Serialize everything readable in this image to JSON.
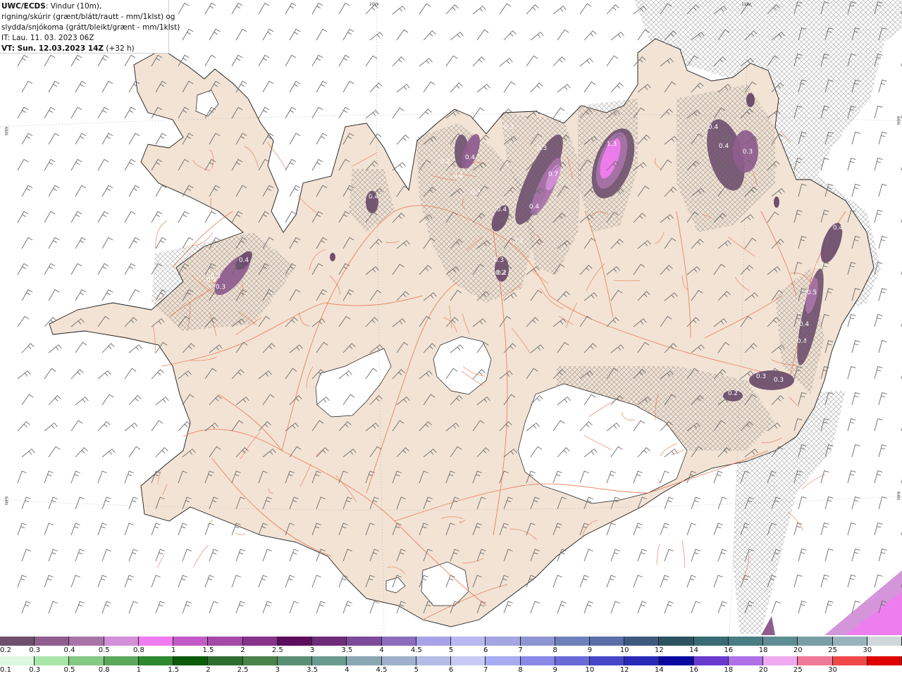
{
  "header": {
    "model": "UWC/ECDS",
    "line1_rest": ": Vindur (10m),",
    "line2": "rigning/skúrir (grænt/blátt/rautt - mm/1klst) og",
    "line3": "slydda/snjókoma (grátt/bleikt/grænt - mm/1klst)",
    "line4": "IT: Lau. 11. 03. 2023 06Z",
    "line5_bold": "VT: Sun. 12.03.2023 14Z",
    "line5_rest": " (+32 h)"
  },
  "grid_labels": {
    "top": [
      "20W",
      "15W"
    ],
    "left": [
      "66N",
      "64N"
    ],
    "right": [
      "66N",
      "64N"
    ]
  },
  "precip_labels": [
    {
      "text": "0.3"
    },
    {
      "text": "0.3"
    },
    {
      "text": "0.3"
    },
    {
      "text": "0.2"
    },
    {
      "text": "0.4"
    },
    {
      "text": "0.4"
    },
    {
      "text": "0.2"
    },
    {
      "text": "0.3"
    },
    {
      "text": "0.7"
    },
    {
      "text": "0.4"
    },
    {
      "text": "0.4"
    },
    {
      "text": "0.4"
    },
    {
      "text": "0.3"
    },
    {
      "text": "0.3"
    },
    {
      "text": "0.2"
    },
    {
      "text": "1.3"
    },
    {
      "text": "0.4"
    },
    {
      "text": "0.4"
    },
    {
      "text": "0.3"
    },
    {
      "text": "0.4"
    },
    {
      "text": "0.3"
    },
    {
      "text": "0.5"
    },
    {
      "text": "0.4"
    },
    {
      "text": "0.4"
    },
    {
      "text": "0.3"
    },
    {
      "text": "0.3"
    },
    {
      "text": "0.2"
    },
    {
      "text": "0.4"
    },
    {
      "text": "0.3"
    },
    {
      "text": "0.3"
    }
  ],
  "legend_snow": {
    "labels": [
      "0.2",
      "0.3",
      "0.4",
      "0.5",
      "0.8",
      "1",
      "1.5",
      "2",
      "2.5",
      "3",
      "3.5",
      "4",
      "4.5",
      "5",
      "6",
      "7",
      "8",
      "9",
      "10",
      "12",
      "14",
      "16",
      "18",
      "20",
      "25",
      "30"
    ],
    "colors": [
      "#6e4f6e",
      "#8f5e8f",
      "#a874a8",
      "#d38fd8",
      "#f07cf0",
      "#c45ac8",
      "#a548a8",
      "#86338b",
      "#5c0d5c",
      "#6d2b7a",
      "#7b4a9a",
      "#8d6bbd",
      "#a9a2e8",
      "#b9b8f0",
      "#a3a6e0",
      "#8d95d2",
      "#6e80bb",
      "#5a6ea8",
      "#3f5a80",
      "#2b5360",
      "#3a6a73",
      "#4a7c84",
      "#5f8d95",
      "#7b9ea6",
      "#99b3bb",
      "#cfd7db"
    ]
  },
  "legend_rain": {
    "labels": [
      "0.1",
      "0.3",
      "0.5",
      "0.8",
      "1",
      "1.5",
      "2",
      "2.5",
      "3",
      "3.5",
      "4",
      "4.5",
      "5",
      "6",
      "7",
      "8",
      "9",
      "10",
      "12",
      "14",
      "16",
      "18",
      "20",
      "25",
      "30"
    ],
    "colors": [
      "#dff7df",
      "#a9e5a9",
      "#84c984",
      "#5aa85a",
      "#2f8a2f",
      "#0a5a0a",
      "#2e6e2e",
      "#4a824a",
      "#5b8f73",
      "#6b9a8e",
      "#8aa7b3",
      "#9fb0cc",
      "#b4bce6",
      "#c6caf5",
      "#a7acf0",
      "#8889e6",
      "#6a6ad8",
      "#4646c8",
      "#2a2ab8",
      "#0a0aa0",
      "#6a3ad0",
      "#b070e8",
      "#f0a8f0",
      "#f07898",
      "#f04848",
      "#e00000"
    ]
  },
  "colors": {
    "land": "#f2e3d5",
    "glacier": "#ffffff",
    "coast": "#1a1a1a",
    "roads": "#e8734a",
    "wind_barbs": "#6a6a6a",
    "sea": "#ffffff"
  }
}
